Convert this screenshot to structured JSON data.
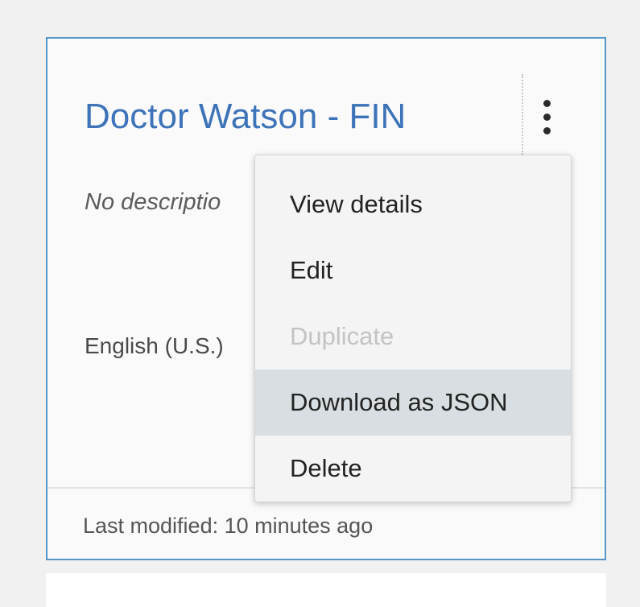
{
  "card": {
    "title": "Doctor Watson - FIN",
    "description": "No descriptio",
    "language": "English (U.S.)",
    "last_modified": "Last modified: 10 minutes ago",
    "overflow_icon": "vertical-ellipsis-icon"
  },
  "menu": {
    "items": [
      {
        "label": "View details",
        "state": "enabled"
      },
      {
        "label": "Edit",
        "state": "enabled"
      },
      {
        "label": "Duplicate",
        "state": "disabled"
      },
      {
        "label": "Download as JSON",
        "state": "highlighted"
      },
      {
        "label": "Delete",
        "state": "enabled"
      }
    ]
  },
  "colors": {
    "page_background": "#f1f1f1",
    "card_border": "#5596c8",
    "title": "#3d73b8",
    "menu_background": "#f4f4f4",
    "menu_highlight": "#d8dee1",
    "disabled_text": "#c3c3c3"
  }
}
